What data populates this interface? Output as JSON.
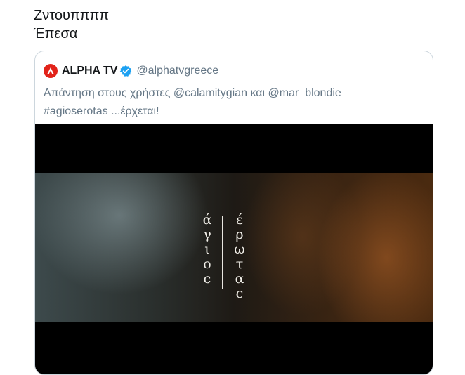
{
  "tweet": {
    "lines": [
      "Ζντουππππ",
      "Έπεσα"
    ]
  },
  "quote": {
    "display_name": "ALPHA TV",
    "handle": "@alphatvgreece",
    "body_line1": "Απάντηση στους χρήστες @calamitygian και @mar_blondie",
    "body_line2": "#agioserotas ...έρχεται!"
  },
  "media": {
    "title_left": [
      "ά",
      "γ",
      "ι",
      "ο",
      "c"
    ],
    "title_right": [
      "έ",
      "ρ",
      "ω",
      "τ",
      "α",
      "c"
    ]
  },
  "colors": {
    "brand_red": "#e2231a",
    "verified_blue": "#1da1f2",
    "muted_text": "#657786",
    "border": "#ccd6dd"
  }
}
